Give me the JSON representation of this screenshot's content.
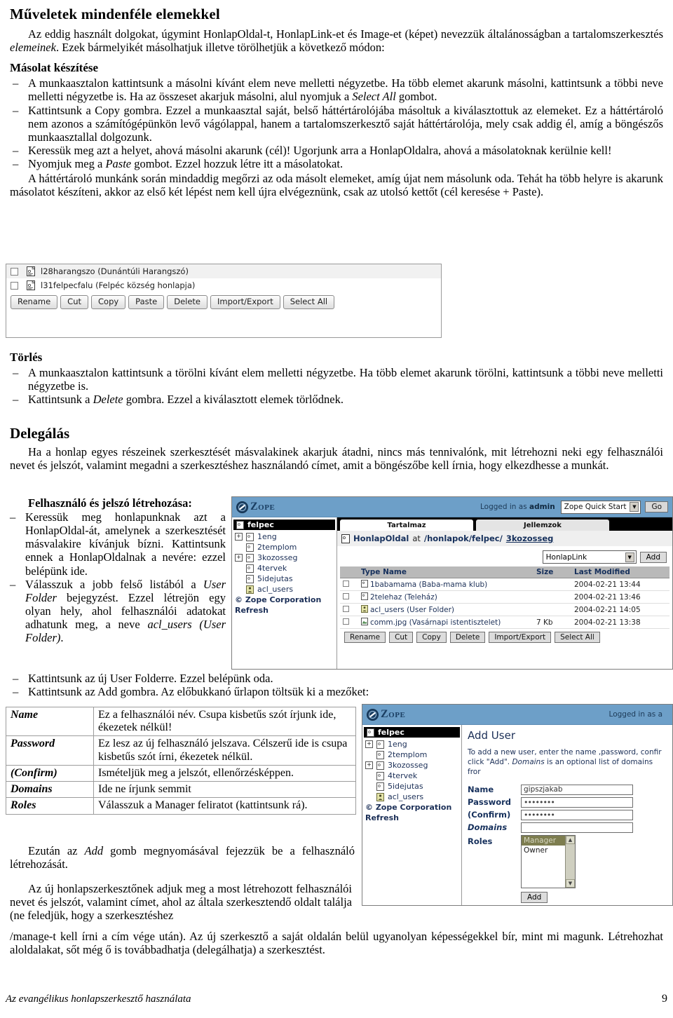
{
  "document": {
    "heading_main": "Műveletek  mindenféle elemekkel",
    "intro": "Az eddig használt dolgokat, úgymint HonlapOldal-t, HonlapLink-et és Image-et (képet) nevezzük általánosságban a tartalomszerkesztés elemeinek. Ezek bármelyikét másolhatjuk illetve törölhetjük a következő módon:",
    "intro_part1": "Az eddig használt dolgokat, úgymint HonlapOldal-t, HonlapLink-et és Image-et (képet) nevezzük általánosságban a tartalomszerkesztés ",
    "intro_italic": "elemeinek",
    "intro_part2": ". Ezek bármelyikét másolhatjuk illetve törölhetjük a következő módon:",
    "section_copy_title": "Másolat készítése",
    "copy_items": [
      {
        "part1": "A munkaasztalon kattintsunk a másolni kívánt elem neve melletti négyzetbe. Ha több elemet akarunk másolni, kattintsunk a többi neve melletti négyzetbe is. Ha az összeset akarjuk másolni, alul nyomjuk a ",
        "italic": "Select All",
        "part2": " gombot."
      },
      {
        "part1": "Kattintsunk a Copy gombra. Ezzel a munkaasztal saját, belső háttértárolójába másoltuk a kiválasztottuk az elemeket. Ez a háttértároló nem azonos a számítógépünkön levő vágólappal, hanem a tartalomszerkesztő saját háttértárolója, mely csak addig él, amíg a böngészős munkaasztallal dolgozunk.",
        "italic": "",
        "part2": ""
      },
      {
        "part1": "Keressük meg azt a helyet, ahová másolni akarunk (cél)! Ugorjunk arra a HonlapOldalra, ahová a másolatoknak kerülnie kell!",
        "italic": "",
        "part2": ""
      },
      {
        "part1": "Nyomjuk meg a ",
        "italic": "Paste",
        "part2": " gombot. Ezzel hozzuk létre itt a másolatokat."
      }
    ],
    "copy_closing": "A háttértároló munkánk során mindaddig megőrzi az oda másolt elemeket, amíg újat nem másolunk oda. Tehát ha több helyre is akarunk másolatot készíteni, akkor az első két lépést nem kell újra elvégeznünk, csak az utolsó kettőt (cél keresése + Paste).",
    "section_delete_title": "Törlés",
    "delete_items": [
      {
        "part1": "A munkaasztalon kattintsunk a törölni kívánt elem melletti négyzetbe. Ha több elemet akarunk törölni, kattintsunk a többi neve melletti négyzetbe is.",
        "italic": "",
        "part2": ""
      },
      {
        "part1": "Kattintsunk a ",
        "italic": "Delete",
        "part2": " gombra. Ezzel a kiválasztott elemek törlődnek."
      }
    ],
    "section_delegate_title": "Delegálás",
    "delegate_intro": "Ha a honlap egyes részeinek szerkesztését másvalakinek akarjuk átadni, nincs más tennivalónk, mit létrehozni neki egy felhasználói nevet és jelszót, valamint megadni a szerkesztéshez használandó címet, amit a böngészőbe kell írnia, hogy elkezdhesse a munkát.",
    "subsection_user_title": "Felhasználó és jelszó létrehozása:",
    "user_items": [
      {
        "part1": "Keressük meg honlapunknak azt a HonlapOldal-át, amelynek a szerkesztését másvalakire kívánjuk bízni. Kattintsunk ennek a HonlapOldalnak a nevére: ezzel belépünk ide.",
        "italic": "",
        "part2": ""
      },
      {
        "part1": "Válasszuk a jobb felső listából a ",
        "italic": "User Folder",
        "part2": " bejegyzést. Ezzel létrejön egy olyan hely, ahol felhasználói adatokat adhatunk meg, a neve ",
        "italic2": "acl_users (User Folder)",
        "part3": "."
      },
      {
        "part1": "Kattintsunk az új User Folderre. Ezzel belépünk oda.",
        "italic": "",
        "part2": ""
      },
      {
        "part1": "Kattintsunk az Add gombra. Az előbukkanó űrlapon töltsük ki a mezőket:",
        "italic": "",
        "part2": ""
      }
    ],
    "closing_1_part1": "Ezután az ",
    "closing_1_italic": "Add",
    "closing_1_part2": " gomb megnyomásával fejezzük be a felhasználó létrehozását.",
    "closing_2": "Az új honlapszerkesztőnek adjuk meg a most létrehozott felhasználói nevet és jelszót, valamint címet, ahol az általa szerkesztendő oldalt találja (ne feledjük, hogy a szerkesztéshez /manage-t kell írni a cím vége után). Az új szerkesztő a saját oldalán belül ugyanolyan képességekkel bír, mint mi magunk. Létrehozhat aloldalakat, sőt még ő is továbbadhatja (delegálhatja) a szerkesztést."
  },
  "field_table": {
    "rows": [
      {
        "key": "Name",
        "value": "Ez a felhasználói név. Csupa kisbetűs szót írjunk ide, ékezetek nélkül!"
      },
      {
        "key": "Password",
        "value": "Ez lesz az új felhasználó jelszava. Célszerű ide is csupa kisbetűs szót írni, ékezetek nélkül."
      },
      {
        "key": "(Confirm)",
        "value": "Ismételjük meg a jelszót, ellenőrzésképpen."
      },
      {
        "key": "Domains",
        "value": "Ide ne írjunk semmit"
      },
      {
        "key": "Roles",
        "value": "Válasszuk a Manager feliratot (kattintsunk rá)."
      }
    ]
  },
  "screenshot_elements": {
    "items": [
      {
        "name": "l28harangszo (Dunántúli Harangszó)"
      },
      {
        "name": "l31felpecfalu (Felpéc község honlapja)"
      }
    ],
    "buttons": [
      "Rename",
      "Cut",
      "Copy",
      "Paste",
      "Delete",
      "Import/Export",
      "Select All"
    ]
  },
  "screenshot_zope": {
    "brand": "Zope",
    "logged_in_prefix": "Logged in as",
    "logged_in_user": "admin",
    "quick_start": "Zope Quick Start",
    "go_label": "Go",
    "tree_root": "felpec",
    "tree_items": [
      {
        "label": "1eng",
        "expandable": true
      },
      {
        "label": "2templom",
        "expandable": false
      },
      {
        "label": "3kozosseg",
        "expandable": true
      },
      {
        "label": "4tervek",
        "expandable": false
      },
      {
        "label": "5idejutas",
        "expandable": false
      },
      {
        "label": "acl_users",
        "expandable": false
      }
    ],
    "tree_footer": [
      "© Zope Corporation",
      "Refresh"
    ],
    "tabs": [
      {
        "label": "Tartalmaz",
        "active": true
      },
      {
        "label": "Jellemzok",
        "active": false
      }
    ],
    "breadcrumb_type": "HonlapOldal",
    "breadcrumb_at": "at",
    "breadcrumb_path": "/honlapok/felpec/",
    "breadcrumb_current": "3kozosseg",
    "add_select_value": "HonlapLink",
    "add_button": "Add",
    "table_headers": [
      "Type",
      "Name",
      "Size",
      "Last Modified"
    ],
    "table_rows": [
      {
        "name": "1babamama (Baba-mama klub)",
        "size": "",
        "modified": "2004-02-21 13:44"
      },
      {
        "name": "2telehaz (Teleház)",
        "size": "",
        "modified": "2004-02-21 13:46"
      },
      {
        "name": "acl_users (User Folder)",
        "size": "",
        "modified": "2004-02-21 14:05"
      },
      {
        "name": "comm.jpg (Vasárnapi istentisztelet)",
        "size": "7 Kb",
        "modified": "2004-02-21 13:38"
      }
    ],
    "buttons": [
      "Rename",
      "Cut",
      "Copy",
      "Delete",
      "Import/Export",
      "Select All"
    ]
  },
  "screenshot_adduser": {
    "brand": "Zope",
    "logged_in_text": "Logged in as a",
    "tree_root": "felpec",
    "tree_items": [
      {
        "label": "1eng",
        "expandable": true
      },
      {
        "label": "2templom",
        "expandable": false
      },
      {
        "label": "3kozosseg",
        "expandable": true
      },
      {
        "label": "4tervek",
        "expandable": false
      },
      {
        "label": "5idejutas",
        "expandable": false
      },
      {
        "label": "acl_users",
        "expandable": false
      }
    ],
    "tree_footer": [
      "© Zope Corporation",
      "Refresh"
    ],
    "title": "Add User",
    "description_line1": "To add a new user, enter the name ,password, confir",
    "description_line2a": "click \"Add\". ",
    "description_line2_italic": "Domains",
    "description_line2b": " is an optional list of domains fror",
    "fields": [
      {
        "label": "Name",
        "value": "gipszjakab",
        "italic": false
      },
      {
        "label": "Password",
        "value": "••••••••",
        "italic": false
      },
      {
        "label": "(Confirm)",
        "value": "••••••••",
        "italic": false
      },
      {
        "label": "Domains",
        "value": "",
        "italic": true
      },
      {
        "label": "Roles",
        "value": "",
        "italic": false
      }
    ],
    "roles_options": [
      {
        "label": "Manager",
        "selected": true
      },
      {
        "label": "Owner",
        "selected": false
      }
    ],
    "add_button": "Add"
  },
  "footer": {
    "left": "Az evangélikus honlapszerkesztő használata",
    "page": "9"
  },
  "colors": {
    "zope_header": "#6d9fc8",
    "tab_active": "#ffffff",
    "tab_bg": "#000000",
    "table_header": "#b9b9b9",
    "link_blue": "#16305c",
    "roles_selected": "#7d7d4f"
  }
}
